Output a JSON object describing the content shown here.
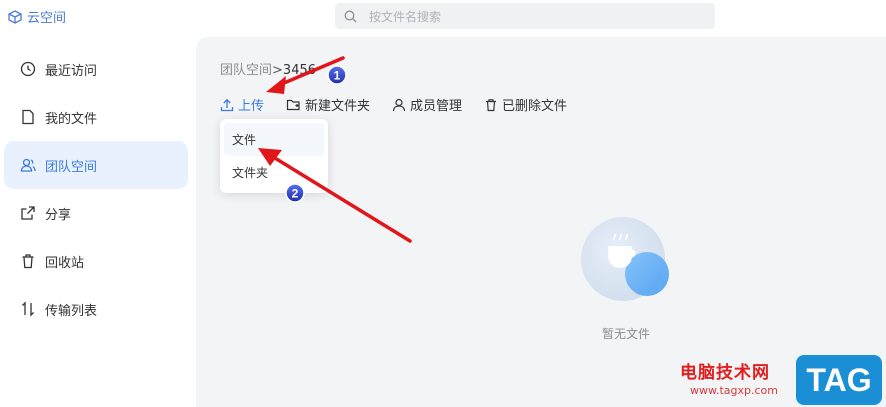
{
  "app": {
    "name": "云空间"
  },
  "search": {
    "placeholder": "按文件名搜索"
  },
  "sidebar": {
    "items": [
      {
        "label": "最近访问",
        "icon": "clock-icon",
        "active": false
      },
      {
        "label": "我的文件",
        "icon": "file-icon",
        "active": false
      },
      {
        "label": "团队空间",
        "icon": "team-icon",
        "active": true
      },
      {
        "label": "分享",
        "icon": "share-icon",
        "active": false
      },
      {
        "label": "回收站",
        "icon": "trash-icon",
        "active": false
      },
      {
        "label": "传输列表",
        "icon": "transfer-icon",
        "active": false
      }
    ]
  },
  "breadcrumb": {
    "root": "团队空间",
    "separator": ">",
    "current": "3456"
  },
  "toolbar": {
    "upload": "上传",
    "new_folder": "新建文件夹",
    "members": "成员管理",
    "deleted": "已删除文件"
  },
  "upload_menu": {
    "items": [
      "文件",
      "文件夹"
    ]
  },
  "empty_state": {
    "text": "暂无文件"
  },
  "annotations": {
    "step1": "1",
    "step2": "2"
  },
  "watermark": {
    "site": "电脑技术网",
    "url": "www.tagxp.com",
    "tag": "TAG"
  },
  "colors": {
    "accent": "#3b7ce0",
    "active_bg": "#e8f1fd",
    "main_bg": "#f3f4f6",
    "arrow": "#e0161b"
  }
}
